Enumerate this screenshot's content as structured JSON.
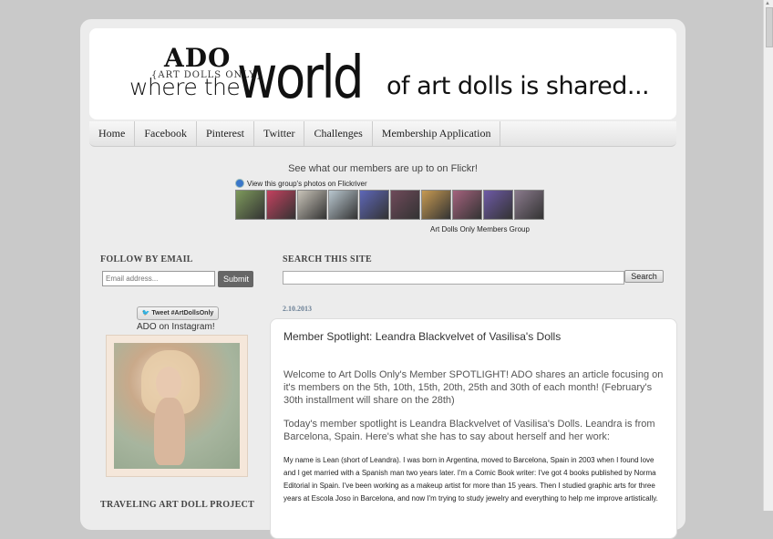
{
  "banner": {
    "ado": "ADO",
    "ado_sub": "{ART DOLLS ONLY}",
    "tag_part1": "where the",
    "tag_world": "world",
    "tag_part2": "of art dolls is shared..."
  },
  "nav": {
    "items": [
      "Home",
      "Facebook",
      "Pinterest",
      "Twitter",
      "Challenges",
      "Membership Application"
    ]
  },
  "flickr": {
    "title": "See what our members are up to on Flickr!",
    "link_text": "View this group's photos on Flickriver",
    "group_label": "Art Dolls Only Members Group",
    "thumb_colors": [
      "#7e9a5c",
      "#c4415f",
      "#c8c3b8",
      "#b9c7cf",
      "#5e67b8",
      "#6f4a5a",
      "#c79a52",
      "#a4627d",
      "#6e5aa6",
      "#8a7a8c"
    ]
  },
  "sidebar": {
    "follow_heading": "FOLLOW BY EMAIL",
    "email_placeholder": "Email address...",
    "submit_label": "Submit",
    "tweet_label": "Tweet #ArtDollsOnly",
    "instagram_label": "ADO on Instagram!",
    "traveling_heading": "TRAVELING ART DOLL PROJECT"
  },
  "search": {
    "heading": "SEARCH THIS SITE",
    "button_label": "Search"
  },
  "post": {
    "date": "2.10.2013",
    "title": "Member Spotlight: Leandra Blackvelvet of Vasilisa's Dolls",
    "p1": "Welcome to Art Dolls Only's Member SPOTLIGHT! ADO shares an article focusing on it's members on the 5th, 10th, 15th, 20th, 25th and 30th of each month! (February's 30th installment will share on the 28th)",
    "p2": "Today's member spotlight is Leandra Blackvelvet of Vasilisa's Dolls. Leandra is from Barcelona, Spain. Here's what she has to say about herself and her work:",
    "p3": "My name is Lean (short of Leandra). I was born in Argentina, moved to Barcelona, Spain in 2003 when I found love and I get married with a Spanish man two years later. I'm a Comic Book writer: I've got 4 books published by Norma Editorial in Spain. I've been working as a makeup artist for more than 15 years. Then I studied graphic arts for three years at Escola Joso in Barcelona, and now I'm trying to study jewelry and everything to help me improve artistically."
  }
}
